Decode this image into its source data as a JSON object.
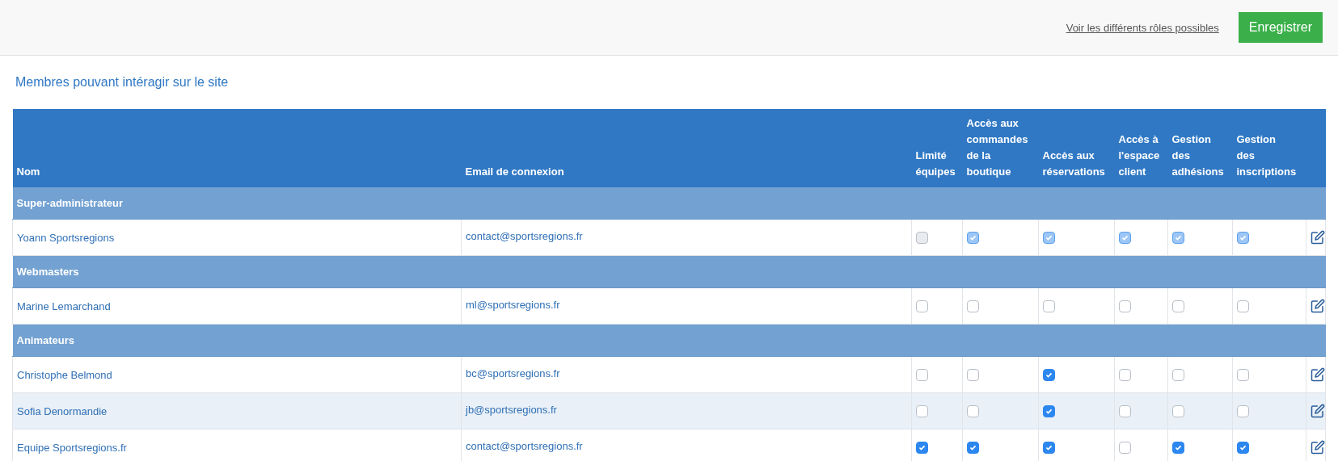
{
  "toolbar": {
    "link": "Voir les différents rôles possibles",
    "button": "Enregistrer"
  },
  "title": "Membres pouvant intéragir sur le site",
  "table": {
    "columns": [
      {
        "lines": [
          "Nom"
        ]
      },
      {
        "lines": [
          "Email de connexion"
        ]
      },
      {
        "lines": [
          "Limité",
          "équipes"
        ]
      },
      {
        "lines": [
          "Accès aux",
          "commandes",
          "de la",
          "boutique"
        ]
      },
      {
        "lines": [
          "Accès aux",
          "réservations"
        ]
      },
      {
        "lines": [
          "Accès à",
          "l'espace",
          "client"
        ]
      },
      {
        "lines": [
          "Gestion",
          "des",
          "adhésions"
        ]
      },
      {
        "lines": [
          "Gestion",
          "des",
          "inscriptions"
        ]
      }
    ],
    "groups": [
      {
        "name": "Super-administrateur",
        "members": [
          {
            "name": "Yoann Sportsregions",
            "email": "contact@sportsregions.fr",
            "striped": false,
            "permissions": [
              {
                "checked": false,
                "disabled": true
              },
              {
                "checked": true,
                "disabled": true
              },
              {
                "checked": true,
                "disabled": true
              },
              {
                "checked": true,
                "disabled": true
              },
              {
                "checked": true,
                "disabled": true
              },
              {
                "checked": true,
                "disabled": true
              }
            ]
          }
        ]
      },
      {
        "name": "Webmasters",
        "members": [
          {
            "name": "Marine Lemarchand",
            "email": "ml@sportsregions.fr",
            "striped": false,
            "permissions": [
              {
                "checked": false,
                "disabled": false
              },
              {
                "checked": false,
                "disabled": false
              },
              {
                "checked": false,
                "disabled": false
              },
              {
                "checked": false,
                "disabled": false
              },
              {
                "checked": false,
                "disabled": false
              },
              {
                "checked": false,
                "disabled": false
              }
            ]
          }
        ]
      },
      {
        "name": "Animateurs",
        "members": [
          {
            "name": "Christophe Belmond",
            "email": "bc@sportsregions.fr",
            "striped": false,
            "permissions": [
              {
                "checked": false,
                "disabled": false
              },
              {
                "checked": false,
                "disabled": false
              },
              {
                "checked": true,
                "disabled": false
              },
              {
                "checked": false,
                "disabled": false
              },
              {
                "checked": false,
                "disabled": false
              },
              {
                "checked": false,
                "disabled": false
              }
            ]
          },
          {
            "name": "Sofia Denormandie",
            "email": "jb@sportsregions.fr",
            "striped": true,
            "permissions": [
              {
                "checked": false,
                "disabled": false
              },
              {
                "checked": false,
                "disabled": false
              },
              {
                "checked": true,
                "disabled": false
              },
              {
                "checked": false,
                "disabled": false
              },
              {
                "checked": false,
                "disabled": false
              },
              {
                "checked": false,
                "disabled": false
              }
            ]
          },
          {
            "name": "Equipe Sportsregions.fr",
            "email": "contact@sportsregions.fr",
            "striped": false,
            "permissions": [
              {
                "checked": true,
                "disabled": false
              },
              {
                "checked": true,
                "disabled": false
              },
              {
                "checked": true,
                "disabled": false
              },
              {
                "checked": false,
                "disabled": false
              },
              {
                "checked": true,
                "disabled": false
              },
              {
                "checked": true,
                "disabled": false
              }
            ]
          }
        ]
      }
    ]
  }
}
